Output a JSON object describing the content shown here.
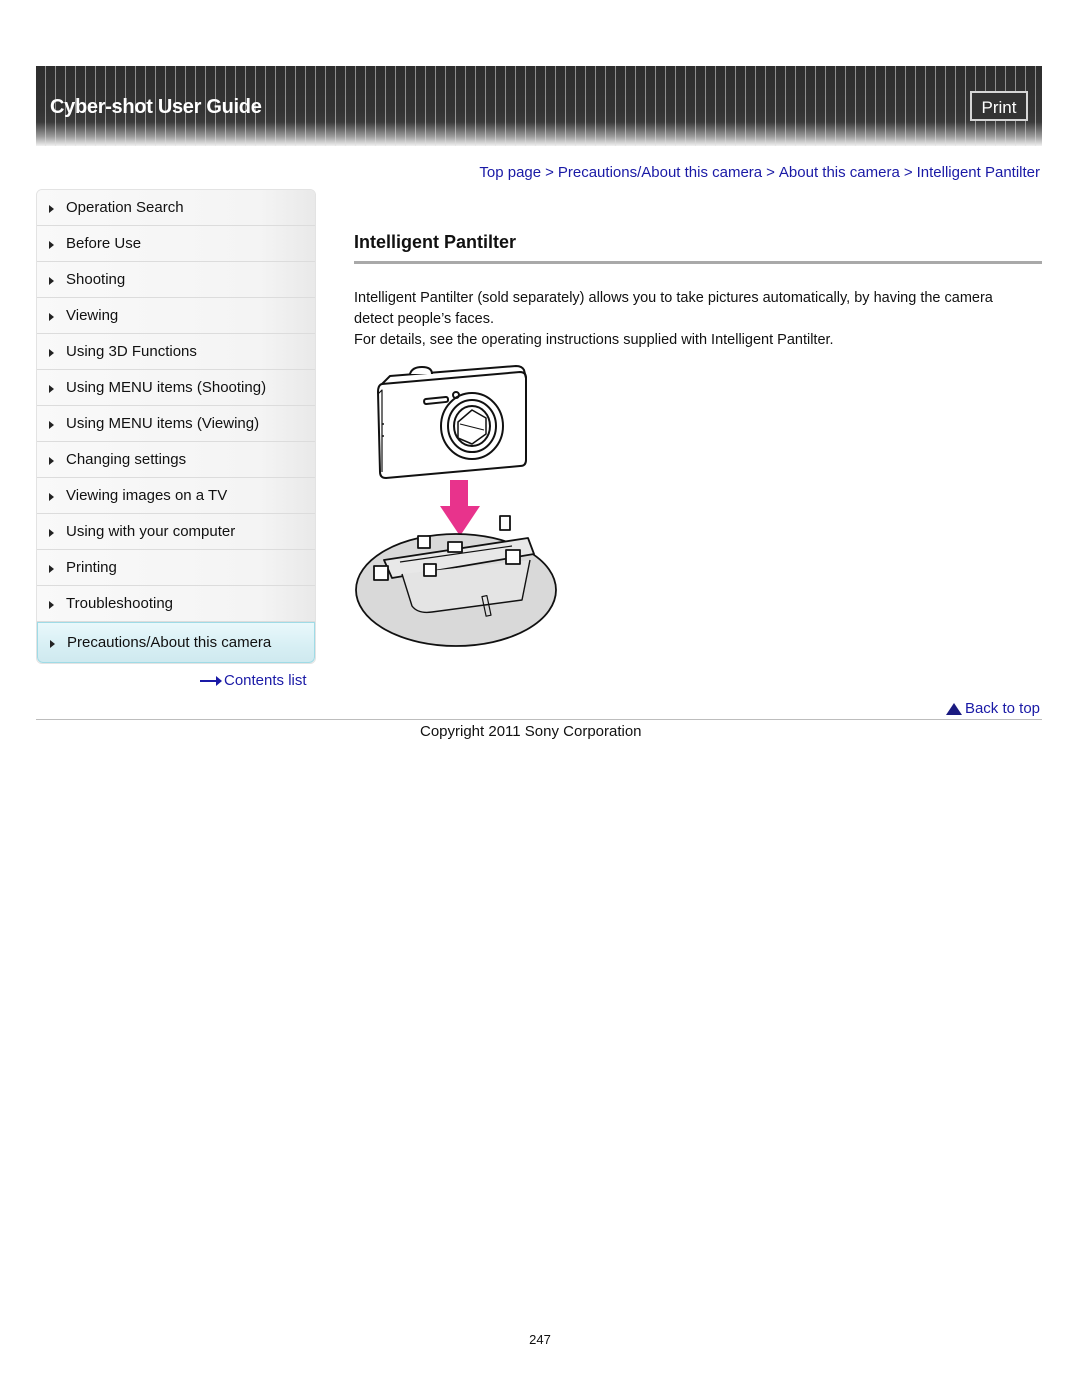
{
  "header": {
    "title": "Cyber-shot User Guide",
    "print_label": "Print"
  },
  "breadcrumb": [
    {
      "label": "Top page"
    },
    {
      "label": "Precautions/About this camera"
    },
    {
      "label": "About this camera"
    },
    {
      "label": "Intelligent Pantilter"
    }
  ],
  "breadcrumb_separator": ">",
  "sidebar": {
    "items": [
      {
        "label": "Operation Search"
      },
      {
        "label": "Before Use"
      },
      {
        "label": "Shooting"
      },
      {
        "label": "Viewing"
      },
      {
        "label": "Using 3D Functions"
      },
      {
        "label": "Using MENU items (Shooting)"
      },
      {
        "label": "Using MENU items (Viewing)"
      },
      {
        "label": "Changing settings"
      },
      {
        "label": "Viewing images on a TV"
      },
      {
        "label": "Using with your computer"
      },
      {
        "label": "Printing"
      },
      {
        "label": "Troubleshooting"
      },
      {
        "label": "Precautions/About this camera",
        "active": true
      }
    ],
    "contents_link": "Contents list"
  },
  "main": {
    "title": "Intelligent Pantilter",
    "paragraphs": [
      "Intelligent Pantilter (sold separately) allows you to take pictures automatically, by having the camera detect people’s faces.",
      "For details, see the operating instructions supplied with Intelligent Pantilter."
    ],
    "illustration": "camera-on-pantilter-illustration"
  },
  "footer": {
    "back_to_top": "Back to top",
    "copyright": "Copyright 2011 Sony Corporation",
    "page_number": "247"
  },
  "colors": {
    "link": "#1a1aa6",
    "active_nav": "#d7eff4",
    "arrow_accent": "#e8338c"
  }
}
